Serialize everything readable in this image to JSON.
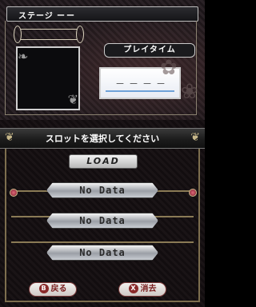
{
  "top": {
    "stage_label": "ステージ",
    "stage_value": "ーー",
    "playtime_label": "プレイタイム",
    "playtime_value": "－－－－"
  },
  "bottom": {
    "message": "スロットを選択してください",
    "title": "LOAD",
    "slots": [
      {
        "label": "No Data"
      },
      {
        "label": "No Data"
      },
      {
        "label": "No Data"
      }
    ],
    "back_button": {
      "key": "B",
      "label": "戻る"
    },
    "delete_button": {
      "key": "X",
      "label": "消去"
    }
  },
  "colors": {
    "gold": "#8a7a55",
    "button_text": "#7a2020",
    "playtime_line": "#6fa2d8"
  }
}
